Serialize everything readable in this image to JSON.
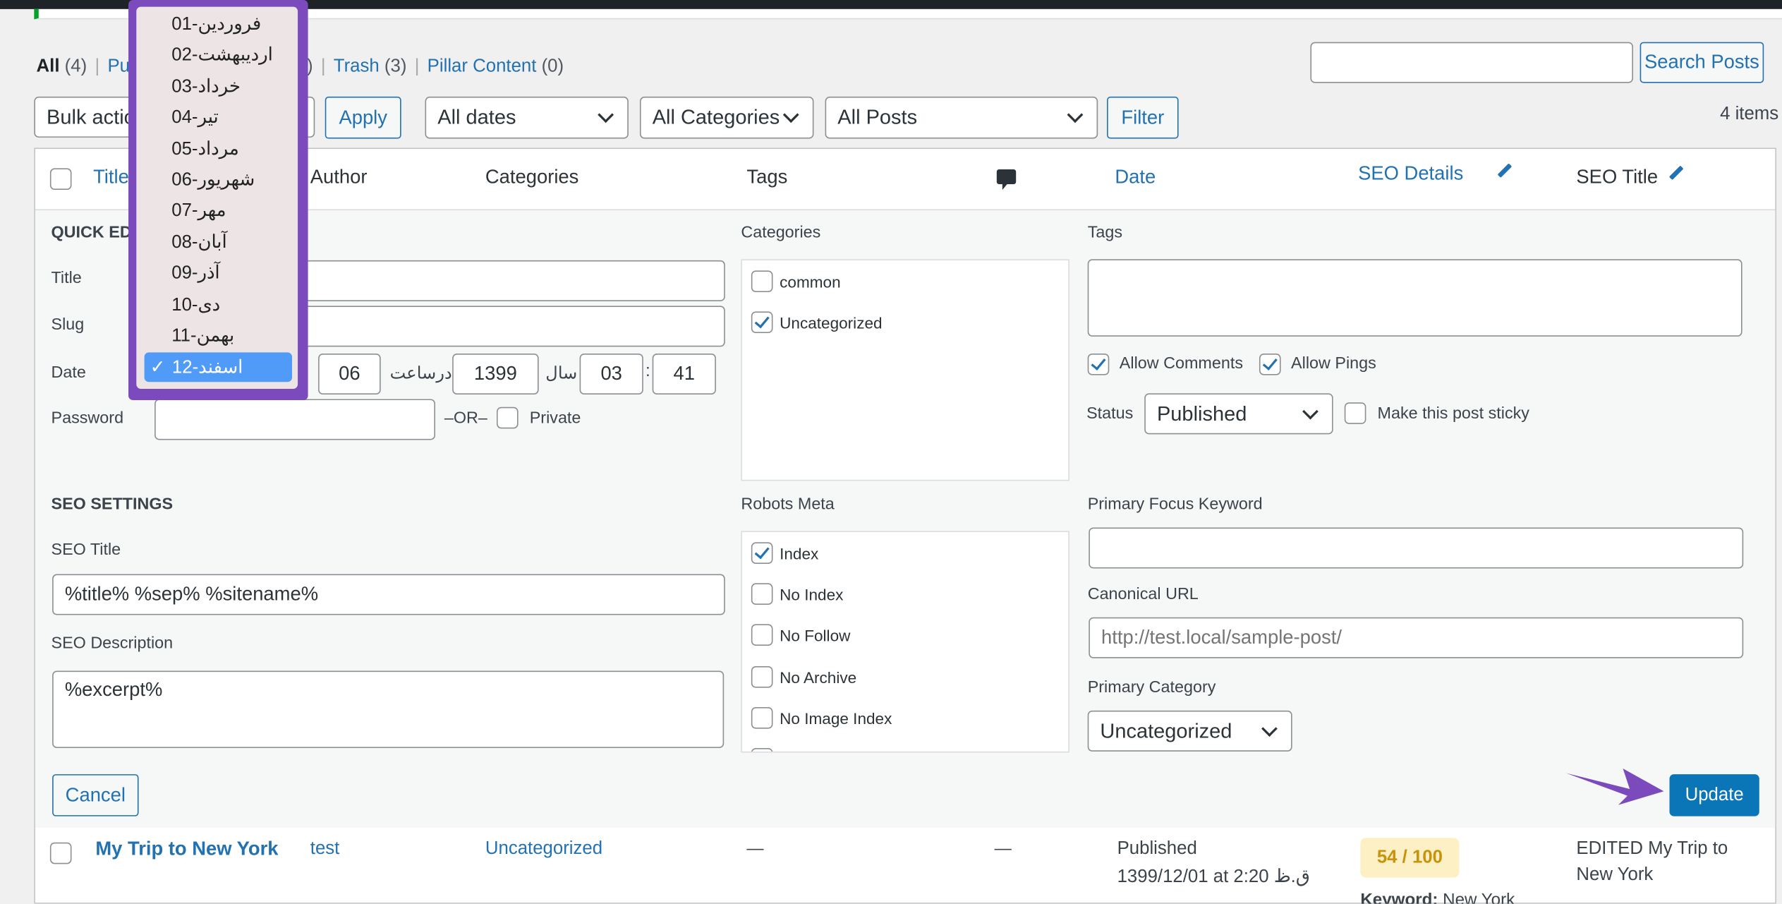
{
  "views": {
    "all": "All",
    "all_count": "(4)",
    "published_partial": "Pu",
    "hidden_tail": ")",
    "trash": "Trash",
    "trash_count": "(3)",
    "pillar": "Pillar Content",
    "pillar_count": "(0)"
  },
  "search": {
    "value": "",
    "button": "Search Posts"
  },
  "toolbar": {
    "bulk": "Bulk actio",
    "apply": "Apply",
    "dates": "All dates",
    "categories": "All Categories",
    "posts": "All Posts",
    "filter": "Filter",
    "items": "4 items"
  },
  "columns": {
    "title": "Title",
    "author": "Author",
    "categories": "Categories",
    "tags": "Tags",
    "date": "Date",
    "seo_details": "SEO Details",
    "seo_title": "SEO Title"
  },
  "quick_edit": {
    "heading": "QUICK EDI",
    "title_label": "Title",
    "slug_label": "Slug",
    "date_label": "Date",
    "password_label": "Password",
    "or": "–OR–",
    "private": "Private",
    "day": "06",
    "at": "درساعت",
    "year": "1399",
    "year_label": "سال",
    "hour": "03",
    "colon": ":",
    "minute": "41",
    "seo_heading": "SEO SETTINGS",
    "seo_title_label": "SEO Title",
    "seo_title_value": "%title% %sep% %sitename%",
    "seo_desc_label": "SEO Description",
    "seo_desc_value": "%excerpt%",
    "cancel": "Cancel",
    "update": "Update",
    "categories_label": "Categories",
    "categories": [
      {
        "label": "common",
        "checked": false
      },
      {
        "label": "Uncategorized",
        "checked": true
      }
    ],
    "robots_label": "Robots Meta",
    "robots": [
      {
        "label": "Index",
        "checked": true
      },
      {
        "label": "No Index",
        "checked": false
      },
      {
        "label": "No Follow",
        "checked": false
      },
      {
        "label": "No Archive",
        "checked": false
      },
      {
        "label": "No Image Index",
        "checked": false
      }
    ],
    "tags_label": "Tags",
    "allow_comments": "Allow Comments",
    "allow_pings": "Allow Pings",
    "status_label": "Status",
    "status": "Published",
    "sticky": "Make this post sticky",
    "focus_label": "Primary Focus Keyword",
    "canonical_label": "Canonical URL",
    "canonical_placeholder": "http://test.local/sample-post/",
    "primary_cat_label": "Primary Category",
    "primary_cat": "Uncategorized"
  },
  "month_dropdown": {
    "options": [
      "01-فروردین",
      "02-اردیبهشت",
      "03-خرداد",
      "04-تیر",
      "05-مرداد",
      "06-شهریور",
      "07-مهر",
      "08-آبان",
      "09-آذر",
      "10-دی",
      "11-بهمن"
    ],
    "selected": "12-اسفند",
    "check": "✓"
  },
  "row": {
    "title": "My Trip to New York",
    "author": "test",
    "category": "Uncategorized",
    "tags": "—",
    "comments": "—",
    "status": "Published",
    "date": "1399/12/01 at 2:20 ق.ظ",
    "score": "54 / 100",
    "keyword_label": "Keyword:",
    "keyword": "New York",
    "seo_title_line1": "EDITED My Trip to",
    "seo_title_line2": "New York"
  },
  "colors": {
    "accent": "#2271b1",
    "highlight_frame": "#7b4bbd",
    "selected_option": "#4f9bf7",
    "score_bg": "#fdf0c4",
    "score_text": "#c8920a"
  }
}
